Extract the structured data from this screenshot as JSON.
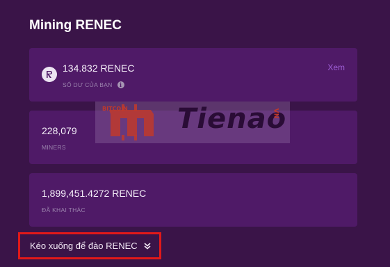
{
  "page": {
    "title": "Mining RENEC"
  },
  "balance_card": {
    "value": "134.832 RENEC",
    "label": "SỐ DƯ CỦA BẠN",
    "view_link": "Xem",
    "coin_icon": "renec-coin-icon",
    "info_icon": "info-icon"
  },
  "miners_card": {
    "value": "228,079",
    "label": "MINERS"
  },
  "mined_card": {
    "value": "1,899,451.4272 RENEC",
    "label": "ĐÃ KHAI THÁC"
  },
  "scroll_cta": {
    "label": "Kéo xuống để đào RENEC",
    "icon": "double-chevron-down-icon"
  },
  "watermark": {
    "text": "Tienao",
    "prefix": "BITCOIN",
    "tag": "VN"
  },
  "colors": {
    "background": "#3a1448",
    "card": "#4f1a67",
    "accent_link": "#a060d8",
    "highlight_border": "#e11919"
  }
}
